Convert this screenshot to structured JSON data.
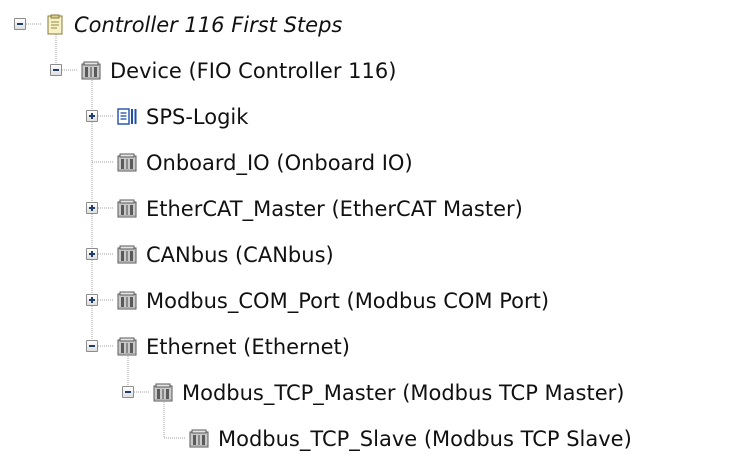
{
  "tree": {
    "nodes": [
      {
        "label": "Controller 116 First Steps",
        "icon": "project-icon",
        "expander": "collapse",
        "italic": true,
        "level": 0
      },
      {
        "label": "Device (FIO Controller 116)",
        "icon": "device-icon",
        "expander": "collapse",
        "italic": false,
        "level": 1
      },
      {
        "label": "SPS-Logik",
        "icon": "plc-logic-icon",
        "expander": "expand",
        "italic": false,
        "level": 2
      },
      {
        "label": "Onboard_IO (Onboard IO)",
        "icon": "device-icon",
        "expander": "none",
        "italic": false,
        "level": 2
      },
      {
        "label": "EtherCAT_Master (EtherCAT Master)",
        "icon": "device-icon",
        "expander": "expand",
        "italic": false,
        "level": 2
      },
      {
        "label": "CANbus (CANbus)",
        "icon": "device-icon",
        "expander": "expand",
        "italic": false,
        "level": 2
      },
      {
        "label": "Modbus_COM_Port (Modbus COM Port)",
        "icon": "device-icon",
        "expander": "expand",
        "italic": false,
        "level": 2
      },
      {
        "label": "Ethernet (Ethernet)",
        "icon": "device-icon",
        "expander": "collapse",
        "italic": false,
        "level": 2
      },
      {
        "label": "Modbus_TCP_Master (Modbus TCP Master)",
        "icon": "device-icon",
        "expander": "collapse",
        "italic": false,
        "level": 3
      },
      {
        "label": "Modbus_TCP_Slave (Modbus TCP Slave)",
        "icon": "device-icon",
        "expander": "none",
        "italic": false,
        "level": 4
      }
    ]
  },
  "colors": {
    "tree_line": "#a0a0a0",
    "text": "#111111",
    "device_icon_fill": "#c9c9c9",
    "device_icon_dark": "#5a5a5a",
    "project_icon_fill": "#f7f1c8",
    "project_icon_stroke": "#8a7a3a",
    "plc_icon_blue": "#1f4fa8"
  }
}
